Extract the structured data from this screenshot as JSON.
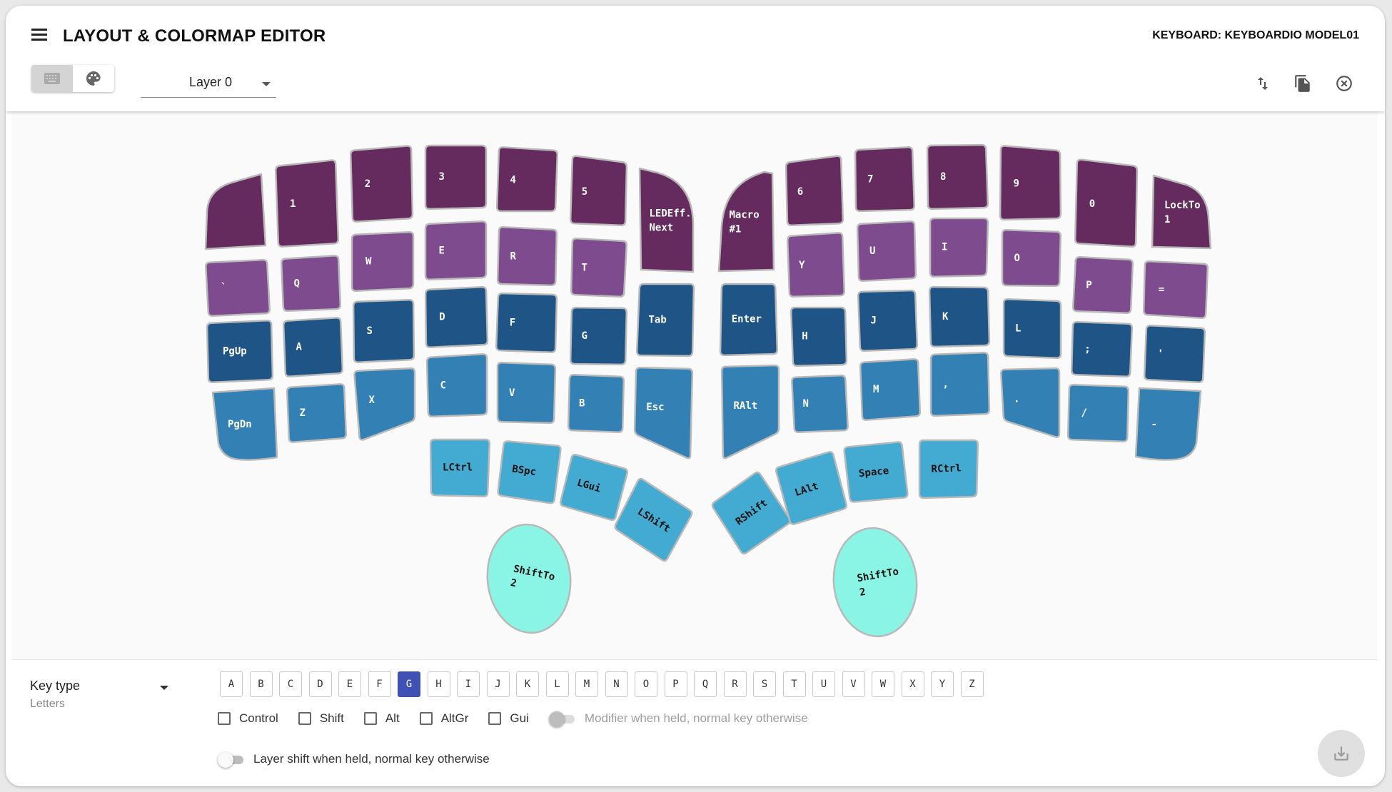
{
  "app": {
    "title": "LAYOUT & COLORMAP EDITOR",
    "keyboard_label": "KEYBOARD: KEYBOARDIO MODEL01"
  },
  "toolbar": {
    "layer_select": "Layer 0",
    "mode_buttons": [
      {
        "icon": "keyboard-icon",
        "active": true
      },
      {
        "icon": "palette-icon",
        "active": false
      }
    ],
    "actions": [
      "swap-vert-icon",
      "copy-icon",
      "clear-icon"
    ]
  },
  "colors": {
    "plum": "#652b5e",
    "purple": "#7e4b8f",
    "navy": "#1f5586",
    "steel": "#3380b4",
    "sky": "#43abd2",
    "mint": "#8af5e4",
    "selected_outline": "#f4a6a6",
    "accent": "#3f51b5"
  },
  "keys": [
    {
      "id": "l-r0c0",
      "label": "",
      "color": "plum"
    },
    {
      "id": "l-r0c1",
      "label": "1",
      "color": "plum"
    },
    {
      "id": "l-r0c2",
      "label": "2",
      "color": "plum"
    },
    {
      "id": "l-r0c3",
      "label": "3",
      "color": "plum"
    },
    {
      "id": "l-r0c4",
      "label": "4",
      "color": "plum"
    },
    {
      "id": "l-r0c5",
      "label": "5",
      "color": "plum"
    },
    {
      "id": "l-r0c6",
      "label": "LEDEff.\nNext",
      "color": "plum"
    },
    {
      "id": "l-r1c0",
      "label": "`",
      "color": "purple"
    },
    {
      "id": "l-r1c1",
      "label": "Q",
      "color": "purple"
    },
    {
      "id": "l-r1c2",
      "label": "W",
      "color": "purple"
    },
    {
      "id": "l-r1c3",
      "label": "E",
      "color": "purple"
    },
    {
      "id": "l-r1c4",
      "label": "R",
      "color": "purple"
    },
    {
      "id": "l-r1c5",
      "label": "T",
      "color": "purple"
    },
    {
      "id": "l-r1c6",
      "label": "Tab",
      "color": "navy"
    },
    {
      "id": "l-r2c0",
      "label": "PgUp",
      "color": "navy"
    },
    {
      "id": "l-r2c1",
      "label": "A",
      "color": "navy"
    },
    {
      "id": "l-r2c2",
      "label": "S",
      "color": "navy"
    },
    {
      "id": "l-r2c3",
      "label": "D",
      "color": "navy"
    },
    {
      "id": "l-r2c4",
      "label": "F",
      "color": "navy"
    },
    {
      "id": "l-r2c5",
      "label": "G",
      "color": "navy",
      "selected": true
    },
    {
      "id": "l-r3c0",
      "label": "PgDn",
      "color": "steel"
    },
    {
      "id": "l-r3c1",
      "label": "Z",
      "color": "steel"
    },
    {
      "id": "l-r3c2",
      "label": "X",
      "color": "steel"
    },
    {
      "id": "l-r3c3",
      "label": "C",
      "color": "steel"
    },
    {
      "id": "l-r3c4",
      "label": "V",
      "color": "steel"
    },
    {
      "id": "l-r3c5",
      "label": "B",
      "color": "steel"
    },
    {
      "id": "l-r3c6",
      "label": "Esc",
      "color": "steel"
    },
    {
      "id": "l-t0",
      "label": "LCtrl",
      "color": "sky"
    },
    {
      "id": "l-t1",
      "label": "BSpc",
      "color": "sky"
    },
    {
      "id": "l-t2",
      "label": "LGui",
      "color": "sky"
    },
    {
      "id": "l-t3",
      "label": "LShift",
      "color": "sky"
    },
    {
      "id": "l-palm",
      "label": "ShiftTo\n2",
      "color": "mint"
    },
    {
      "id": "r-r0c0",
      "label": "Macro\n#1",
      "color": "plum"
    },
    {
      "id": "r-r0c1",
      "label": "6",
      "color": "plum"
    },
    {
      "id": "r-r0c2",
      "label": "7",
      "color": "plum"
    },
    {
      "id": "r-r0c3",
      "label": "8",
      "color": "plum"
    },
    {
      "id": "r-r0c4",
      "label": "9",
      "color": "plum"
    },
    {
      "id": "r-r0c5",
      "label": "0",
      "color": "plum"
    },
    {
      "id": "r-r0c6",
      "label": "LockTo\n1",
      "color": "plum"
    },
    {
      "id": "r-r1c0",
      "label": "Enter",
      "color": "navy"
    },
    {
      "id": "r-r1c1",
      "label": "Y",
      "color": "purple"
    },
    {
      "id": "r-r1c2",
      "label": "U",
      "color": "purple"
    },
    {
      "id": "r-r1c3",
      "label": "I",
      "color": "purple"
    },
    {
      "id": "r-r1c4",
      "label": "O",
      "color": "purple"
    },
    {
      "id": "r-r1c5",
      "label": "P",
      "color": "purple"
    },
    {
      "id": "r-r1c6",
      "label": "=",
      "color": "purple"
    },
    {
      "id": "r-r2c1",
      "label": "H",
      "color": "navy"
    },
    {
      "id": "r-r2c2",
      "label": "J",
      "color": "navy"
    },
    {
      "id": "r-r2c3",
      "label": "K",
      "color": "navy"
    },
    {
      "id": "r-r2c4",
      "label": "L",
      "color": "navy"
    },
    {
      "id": "r-r2c5",
      "label": ";",
      "color": "navy"
    },
    {
      "id": "r-r2c6",
      "label": "'",
      "color": "navy"
    },
    {
      "id": "r-r3c0",
      "label": "RAlt",
      "color": "steel"
    },
    {
      "id": "r-r3c1",
      "label": "N",
      "color": "steel"
    },
    {
      "id": "r-r3c2",
      "label": "M",
      "color": "steel"
    },
    {
      "id": "r-r3c3",
      "label": ",",
      "color": "steel"
    },
    {
      "id": "r-r3c4",
      "label": ".",
      "color": "steel"
    },
    {
      "id": "r-r3c5",
      "label": "/",
      "color": "steel"
    },
    {
      "id": "r-r3c6",
      "label": "-",
      "color": "steel"
    },
    {
      "id": "r-t0",
      "label": "RShift",
      "color": "sky"
    },
    {
      "id": "r-t1",
      "label": "LAlt",
      "color": "sky"
    },
    {
      "id": "r-t2",
      "label": "Space",
      "color": "sky"
    },
    {
      "id": "r-t3",
      "label": "RCtrl",
      "color": "sky"
    },
    {
      "id": "r-palm",
      "label": "ShiftTo\n2",
      "color": "mint"
    }
  ],
  "editor": {
    "key_type_label": "Key type",
    "key_type_value": "Letters",
    "letters": [
      "A",
      "B",
      "C",
      "D",
      "E",
      "F",
      "G",
      "H",
      "I",
      "J",
      "K",
      "L",
      "M",
      "N",
      "O",
      "P",
      "Q",
      "R",
      "S",
      "T",
      "U",
      "V",
      "W",
      "X",
      "Y",
      "Z"
    ],
    "selected_letter": "G",
    "modifiers": [
      {
        "label": "Control",
        "checked": false
      },
      {
        "label": "Shift",
        "checked": false
      },
      {
        "label": "Alt",
        "checked": false
      },
      {
        "label": "AltGr",
        "checked": false
      },
      {
        "label": "Gui",
        "checked": false
      }
    ],
    "modifier_held_label": "Modifier when held, normal key otherwise",
    "layer_shift_label": "Layer shift when held, normal key otherwise"
  }
}
